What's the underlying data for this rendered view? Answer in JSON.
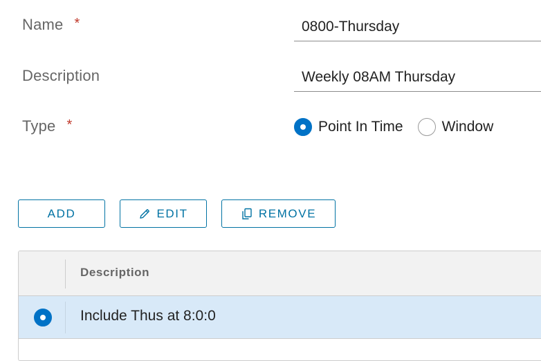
{
  "form": {
    "name_label": "Name",
    "name_required": "*",
    "name_value": "0800-Thursday",
    "description_label": "Description",
    "description_value": "Weekly 08AM Thursday",
    "type_label": "Type",
    "type_required": "*",
    "type_options": [
      {
        "label": "Point In Time",
        "selected": true
      },
      {
        "label": "Window",
        "selected": false
      }
    ]
  },
  "toolbar": {
    "add_label": "ADD",
    "edit_label": "EDIT",
    "remove_label": "REMOVE",
    "edit_icon": "pencil-icon",
    "remove_icon": "copy-icon"
  },
  "grid": {
    "columns": [
      "Description"
    ],
    "rows": [
      {
        "description": "Include Thus at 8:0:0",
        "selected": true
      }
    ]
  },
  "colors": {
    "accent": "#0072a3",
    "radio_selected": "#0072c6",
    "selected_row": "#d8e9f8",
    "required": "#c0392b"
  }
}
